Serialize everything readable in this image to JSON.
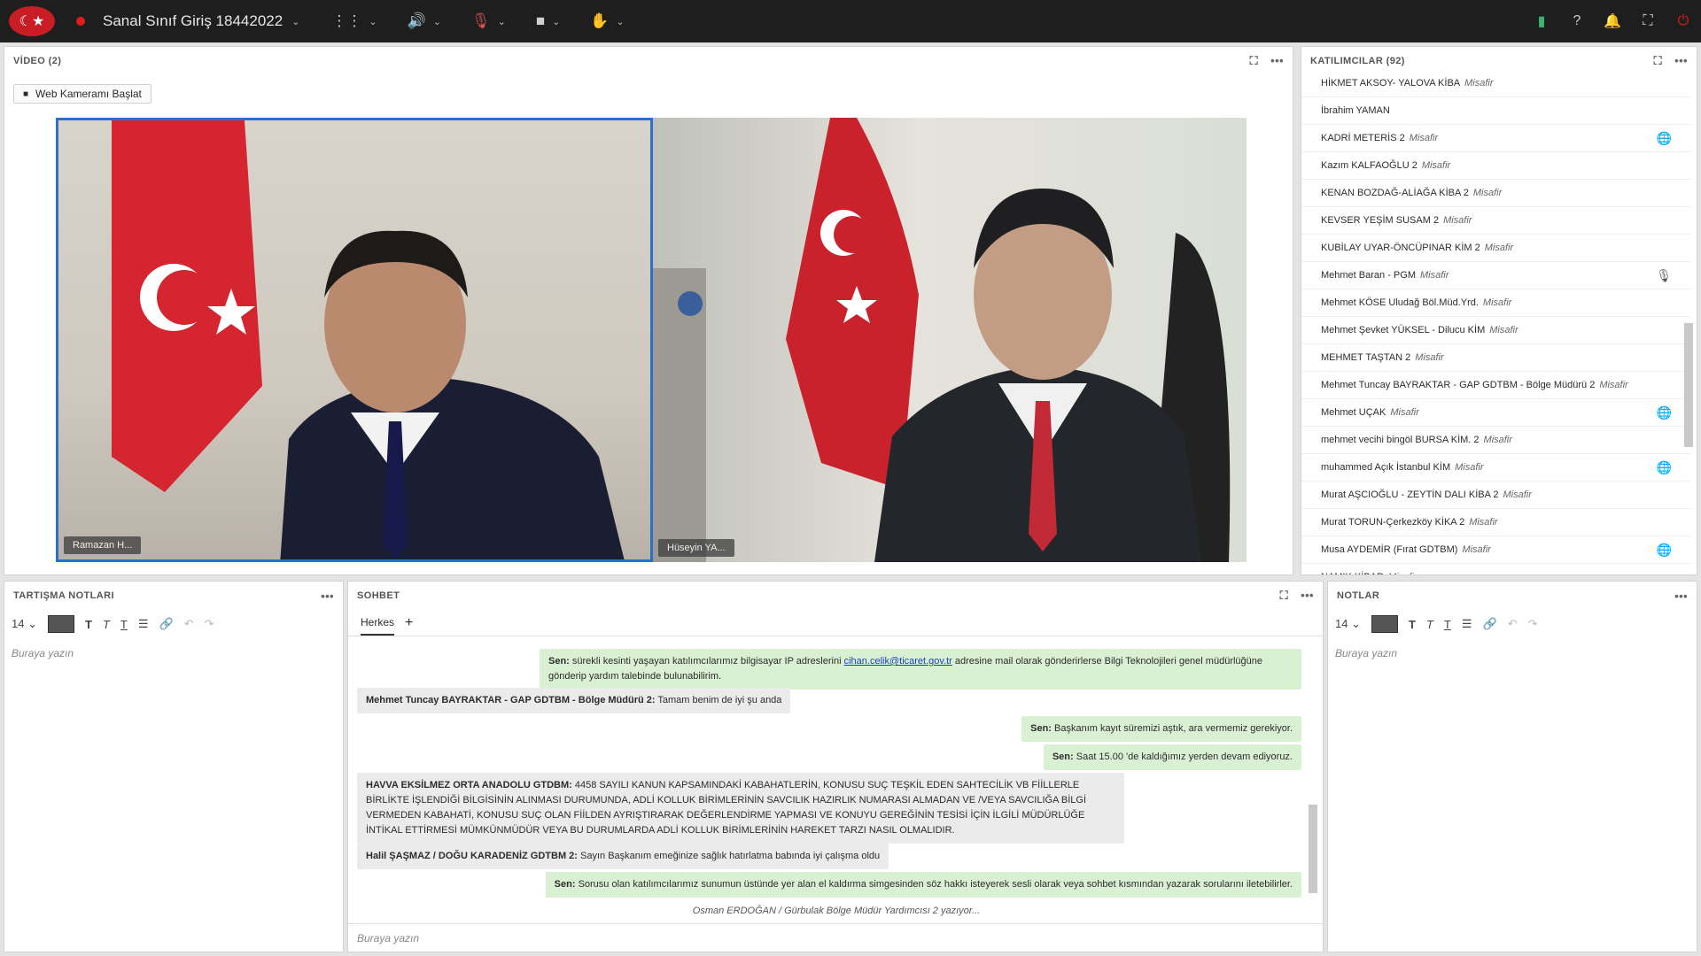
{
  "topbar": {
    "title": "Sanal Sınıf Giriş 18442022",
    "colors": {
      "bg": "#1e1e1e",
      "record": "#e01b1b",
      "signal": "#3cb371"
    }
  },
  "video": {
    "header": "VİDEO (2)",
    "cam_button": "Web Kameramı Başlat",
    "tiles": [
      {
        "name": "Ramazan H..."
      },
      {
        "name": "Hüseyin YA..."
      }
    ]
  },
  "participants": {
    "header": "KATILIMCILAR  (92)",
    "items": [
      {
        "name": "HİKMET AKSOY- YALOVA KİBA",
        "tag": "Misafir",
        "icon": ""
      },
      {
        "name": "İbrahim YAMAN",
        "tag": "",
        "icon": ""
      },
      {
        "name": "KADRİ METERİS 2",
        "tag": "Misafir",
        "icon": "globe-icon"
      },
      {
        "name": "Kazım KALFAOĞLU 2",
        "tag": "Misafir",
        "icon": ""
      },
      {
        "name": "KENAN BOZDAĞ-ALİAĞA KİBA 2",
        "tag": "Misafir",
        "icon": ""
      },
      {
        "name": "KEVSER YEŞİM SUSAM 2",
        "tag": "Misafir",
        "icon": ""
      },
      {
        "name": "KUBİLAY UYAR-ÖNCÜPINAR KİM 2",
        "tag": "Misafir",
        "icon": ""
      },
      {
        "name": "Mehmet Baran - PGM",
        "tag": "Misafir",
        "icon": "mic-icon"
      },
      {
        "name": "Mehmet KÖSE Uludağ Böl.Müd.Yrd.",
        "tag": "Misafir",
        "icon": ""
      },
      {
        "name": "Mehmet Şevket YÜKSEL - Dilucu KİM",
        "tag": "Misafir",
        "icon": ""
      },
      {
        "name": "MEHMET TAŞTAN 2",
        "tag": "Misafir",
        "icon": ""
      },
      {
        "name": "Mehmet Tuncay BAYRAKTAR - GAP GDTBM - Bölge Müdürü 2",
        "tag": "Misafir",
        "icon": ""
      },
      {
        "name": "Mehmet UÇAK",
        "tag": "Misafir",
        "icon": "globe-icon"
      },
      {
        "name": "mehmet vecihi bingöl BURSA KİM. 2",
        "tag": "Misafir",
        "icon": ""
      },
      {
        "name": "muhammed Açık İstanbul KİM",
        "tag": "Misafir",
        "icon": "globe-icon"
      },
      {
        "name": "Murat AŞCIOĞLU - ZEYTİN DALI KİBA 2",
        "tag": "Misafir",
        "icon": ""
      },
      {
        "name": "Murat TORUN-Çerkezköy KİKA 2",
        "tag": "Misafir",
        "icon": ""
      },
      {
        "name": "Musa AYDEMİR (Fırat GDTBM)",
        "tag": "Misafir",
        "icon": "globe-icon"
      },
      {
        "name": "NAMIK KİBAR",
        "tag": "Misafir",
        "icon": ""
      }
    ]
  },
  "discussion": {
    "header": "TARTIŞMA NOTLARI",
    "font_size": "14",
    "placeholder": "Buraya yazın"
  },
  "chat": {
    "header": "SOHBET",
    "tab": "Herkes",
    "messages": [
      {
        "sender": "Sen:",
        "text": "sürekli kesinti yaşayan katılımcılarımız bilgisayar IP adreslerini",
        "link": "cihan.celik@ticaret.gov.tr",
        "text2": "adresine mail olarak gönderirlerse Bilgi Teknolojileri genel müdürlüğüne gönderip yardım talebinde bulunabilirim."
      },
      {
        "sender": "Mehmet Tuncay BAYRAKTAR - GAP GDTBM - Bölge Müdürü 2:",
        "text": "Tamam benim de iyi şu anda"
      },
      {
        "sender": "Sen:",
        "text": "Başkanım kayıt süremizi aştık, ara vermemiz gerekiyor."
      },
      {
        "sender": "Sen:",
        "text": "Saat 15.00 'de kaldığımız yerden devam ediyoruz."
      },
      {
        "sender": "HAVVA EKSİLMEZ ORTA ANADOLU GTDBM:",
        "text": "4458 SAYILI KANUN KAPSAMINDAKİ KABAHATLERİN, KONUSU SUÇ TEŞKİL EDEN SAHTECİLİK VB FİİLLERLE BİRLİKTE İŞLENDİĞİ BİLGİSİNİN ALINMASI DURUMUNDA, ADLİ KOLLUK BİRİMLERİNİN SAVCILIK HAZIRLIK NUMARASI ALMADAN VE /VEYA SAVCILIĞA BİLGİ VERMEDEN KABAHATİ, KONUSU SUÇ OLAN FİİLDEN AYRIŞTIRARAK DEĞERLENDİRME YAPMASI VE KONUYU GEREĞİNİN TESİSİ İÇİN İLGİLİ MÜDÜRLÜĞE İNTİKAL ETTİRMESİ MÜMKÜNMÜDÜR VEYA BU DURUMLARDA ADLİ KOLLUK BİRİMLERİNİN HAREKET TARZI NASIL OLMALIDIR."
      },
      {
        "sender": "Halil ŞAŞMAZ / DOĞU KARADENİZ GDTBM 2:",
        "text": "Sayın Başkanım emeğinize  sağlık hatırlatma babında iyi çalışma oldu"
      },
      {
        "sender": "Sen:",
        "text": "Sorusu olan katılımcılarımız sunumun üstünde yer alan el kaldırma simgesinden söz hakkı isteyerek sesli olarak veya sohbet kısmından yazarak sorularını iletebilirler."
      }
    ],
    "typing": "Osman ERDOĞAN / Gürbulak Bölge Müdür Yardımcısı 2 yazıyor...",
    "placeholder": "Buraya yazın"
  },
  "notes": {
    "header": "NOTLAR",
    "font_size": "14",
    "placeholder": "Buraya yazın"
  }
}
